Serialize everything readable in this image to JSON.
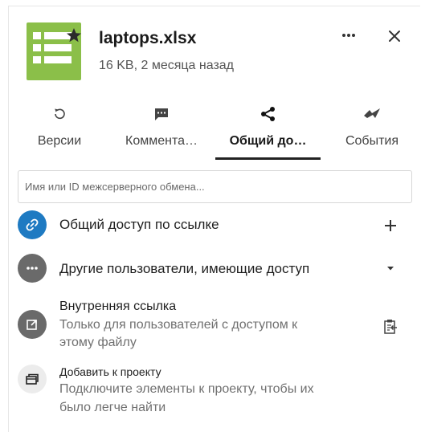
{
  "file": {
    "name": "laptops.xlsx",
    "meta": "16 KB, 2 месяца назад",
    "icon": "spreadsheet-icon",
    "icon_color": "#8bbf49",
    "favorite_icon": "star-icon"
  },
  "header": {
    "menu_icon": "more-horizontal-icon",
    "close_icon": "close-icon"
  },
  "tabs": [
    {
      "label": "Версии",
      "icon": "history-icon",
      "active": false
    },
    {
      "label": "Коммента…",
      "icon": "comment-icon",
      "active": false
    },
    {
      "label": "Общий до…",
      "icon": "share-icon",
      "active": true
    },
    {
      "label": "События",
      "icon": "activity-icon",
      "active": false
    }
  ],
  "search": {
    "placeholder": "Имя или ID межсерверного обмена..."
  },
  "rows": {
    "link_share": {
      "label": "Общий доступ по ссылке",
      "action_icon": "plus-icon",
      "icon_color": "#1e7ac2"
    },
    "others": {
      "label": "Другие пользователи, имеющие доступ",
      "action_icon": "caret-down-icon",
      "icon_color": "#6a6a6a"
    },
    "internal_link": {
      "title": "Внутренняя ссылка",
      "subtitle_line1": "Только для пользователей с доступом к",
      "subtitle_line2": "этому файлу",
      "action_icon": "clipboard-icon",
      "icon_color": "#6a6a6a"
    },
    "add_project": {
      "title": "Добавить к проекту",
      "subtitle_line1": "Подключите элементы к проекту, чтобы их",
      "subtitle_line2": "было легче найти",
      "icon_color": "#ececec"
    }
  }
}
